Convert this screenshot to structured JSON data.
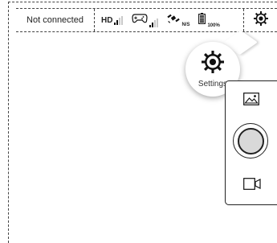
{
  "status_bar": {
    "connection_text": "Not connected",
    "video_link_label": "HD",
    "video_link_bars": 2,
    "remote_bars": 2,
    "gps_text": "N/S",
    "battery_text": "100%"
  },
  "settings_callout": {
    "label": "Settings",
    "icon": "gear-icon"
  },
  "camera_panel": {
    "gallery_icon": "image-icon",
    "shutter_icon": "shutter-button",
    "video_icon": "video-camera-icon"
  }
}
